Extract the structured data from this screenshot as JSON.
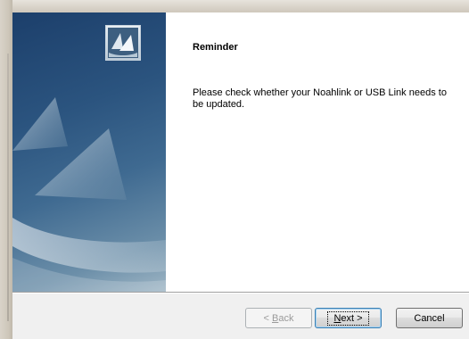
{
  "wizard": {
    "title": "Reminder",
    "message": "Please check whether your Noahlink or USB Link needs to be updated.",
    "icon": "sails-logo-icon"
  },
  "buttons": {
    "back": {
      "prefix": "< ",
      "mnemonic": "B",
      "rest": "ack"
    },
    "next": {
      "mnemonic": "N",
      "rest": "ext >"
    },
    "cancel": "Cancel"
  },
  "colors": {
    "panel_dark": "#1c3f6b",
    "panel_light": "#9fb6c5",
    "content_bg": "#ffffff",
    "footer_bg": "#f0f0f0"
  }
}
